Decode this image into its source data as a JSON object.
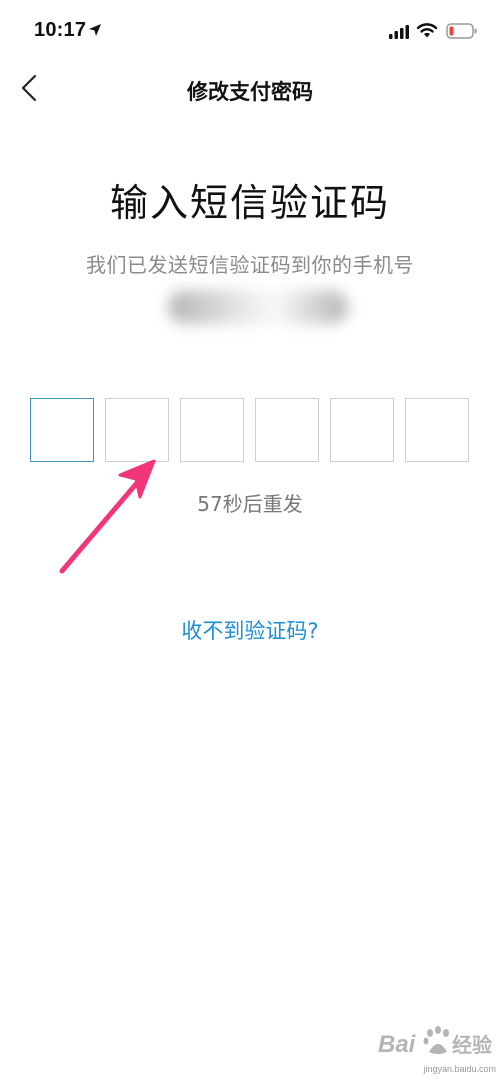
{
  "status_bar": {
    "time": "10:17",
    "icons": [
      "location-arrow-icon",
      "signal-icon",
      "wifi-icon",
      "battery-low-icon"
    ],
    "battery_color": "#e5483b"
  },
  "nav": {
    "back_icon": "chevron-left-icon",
    "title": "修改支付密码"
  },
  "main": {
    "heading": "输入短信验证码",
    "subtitle": "我们已发送短信验证码到你的手机号",
    "code_boxes": [
      "",
      "",
      "",
      "",
      "",
      ""
    ],
    "active_box_index": 0,
    "resend_text": "57秒后重发",
    "help_link": "收不到验证码?"
  },
  "annotation": {
    "arrow_color": "#f2347a"
  },
  "watermark": {
    "logo_text": "Bai",
    "logo_text2": "经验",
    "sub_text": "jingyan.baidu.com"
  },
  "colors": {
    "accent": "#1e8ed6",
    "active_border": "#3d94c9",
    "box_border": "#cfcfcf",
    "secondary_text": "#8a8a8a"
  }
}
